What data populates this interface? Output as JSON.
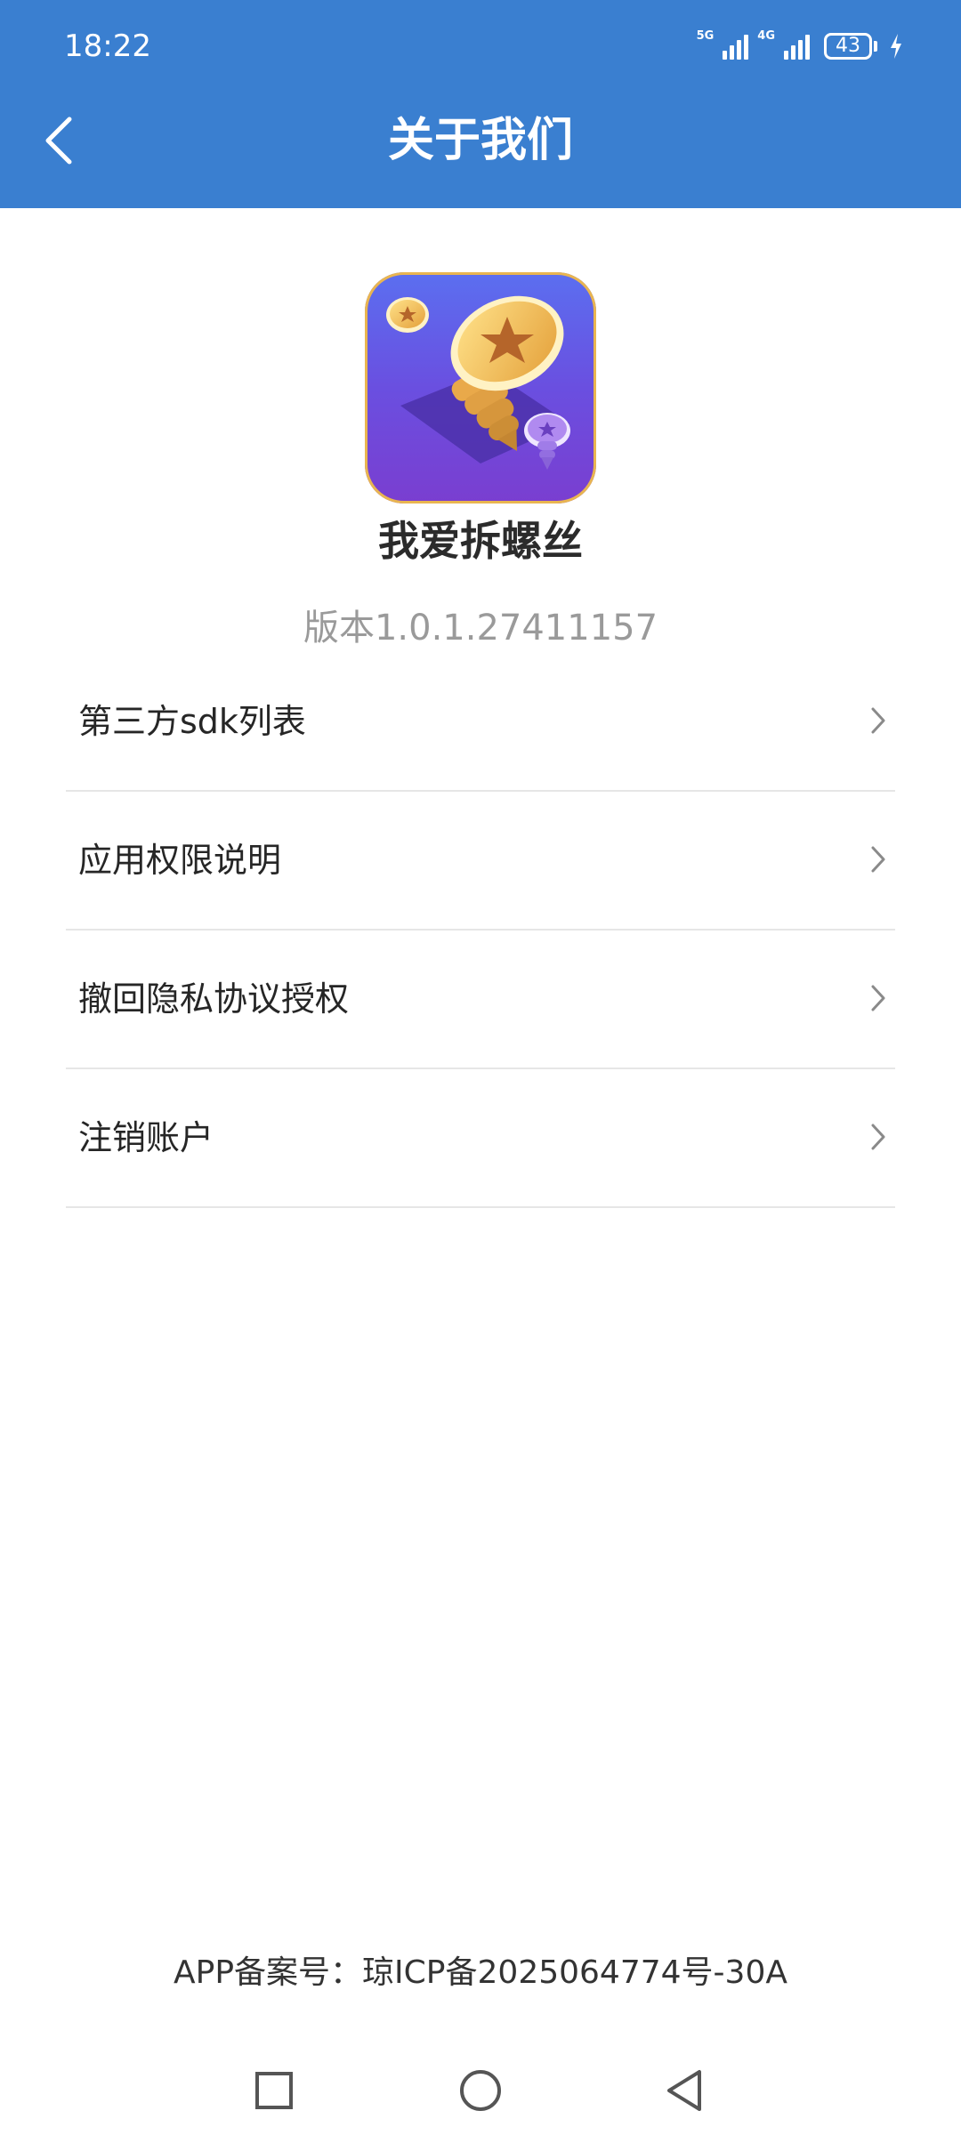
{
  "status_bar": {
    "time": "18:22",
    "network_1": "5G",
    "network_2": "4G",
    "battery": "43",
    "icons": [
      "signal-icon",
      "signal-icon",
      "battery-icon",
      "charging-icon"
    ]
  },
  "header": {
    "title": "关于我们",
    "back_icon": "chevron-left-icon",
    "background_color": "#3a7fd0"
  },
  "app": {
    "icon": "screw-app-icon",
    "name": "我爱拆螺丝",
    "version": "版本1.0.1.27411157"
  },
  "menu": {
    "items": [
      {
        "label": "第三方sdk列表",
        "icon": "chevron-right-icon"
      },
      {
        "label": "应用权限说明",
        "icon": "chevron-right-icon"
      },
      {
        "label": "撤回隐私协议授权",
        "icon": "chevron-right-icon"
      },
      {
        "label": "注销账户",
        "icon": "chevron-right-icon"
      }
    ]
  },
  "footer": {
    "icp": "APP备案号：琼ICP备2025064774号-30A"
  },
  "nav_bar": {
    "buttons": [
      "recents-square-icon",
      "home-circle-icon",
      "back-triangle-icon"
    ]
  }
}
